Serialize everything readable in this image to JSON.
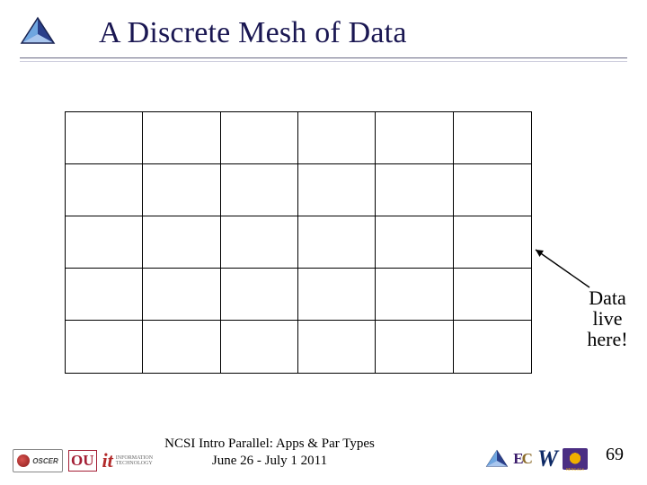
{
  "title": "A Discrete Mesh of Data",
  "mesh": {
    "cols": 6,
    "rows": 5
  },
  "annotation": {
    "line1": "Data",
    "line2": "live",
    "line3": "here!"
  },
  "footer": {
    "line1": "NCSI Intro Parallel: Apps & Par Types",
    "line2": "June 26 - July 1 2011"
  },
  "slide_number": "69",
  "logos": {
    "corner": "triangle-logo",
    "left": [
      {
        "name": "oscer-logo",
        "label": "OSCER"
      },
      {
        "name": "ou-logo",
        "label": "OU"
      },
      {
        "name": "it-logo",
        "label": "it",
        "sub1": "INFORMATION",
        "sub2": "TECHNOLOGY"
      }
    ],
    "right": [
      {
        "name": "triangle-logo-small"
      },
      {
        "name": "ec-logo",
        "label_e": "E",
        "label_c": "C"
      },
      {
        "name": "w-logo",
        "label": "W"
      },
      {
        "name": "lsu-logo",
        "sub": "BENGALS"
      }
    ]
  }
}
